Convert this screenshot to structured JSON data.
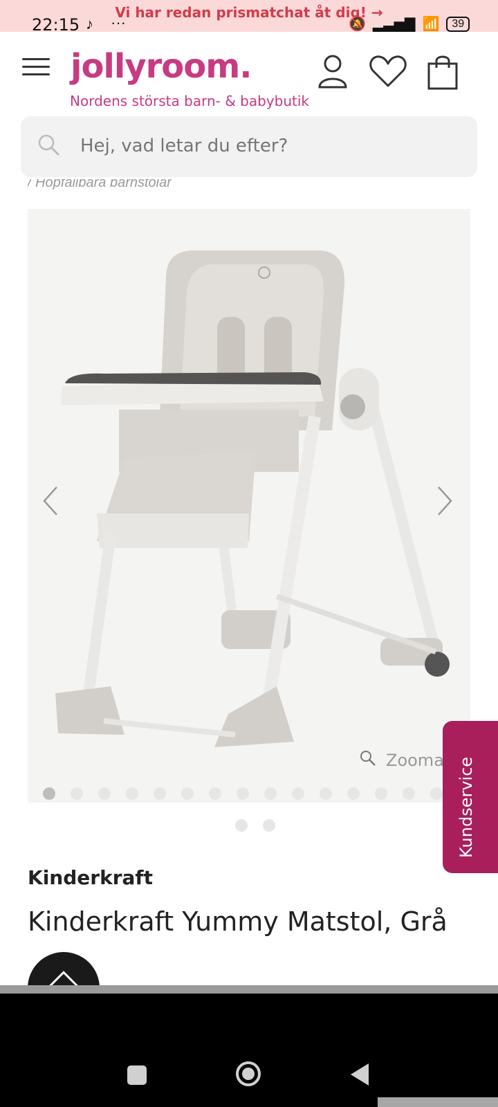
{
  "status_bar": {
    "promo_text": "Vi har redan prismatchat åt dig! →",
    "time": "22:15",
    "more": "···",
    "battery": "39"
  },
  "header": {
    "logo": "jollyroom.",
    "tagline": "Nordens största barn- & babybutik",
    "brand_color": "#c83a81"
  },
  "search": {
    "placeholder": "Hej, vad letar du efter?"
  },
  "breadcrumb": "/ Hopfällbara barnstolar",
  "gallery": {
    "zoom_label": "Zooma",
    "image_dot_count": 15,
    "active_image": 1,
    "page_dot_count": 2
  },
  "side_tab": {
    "label": "Kundservice",
    "color": "#a81f5c"
  },
  "product": {
    "brand": "Kinderkraft",
    "title": "Kinderkraft Yummy Matstol, Grå"
  }
}
